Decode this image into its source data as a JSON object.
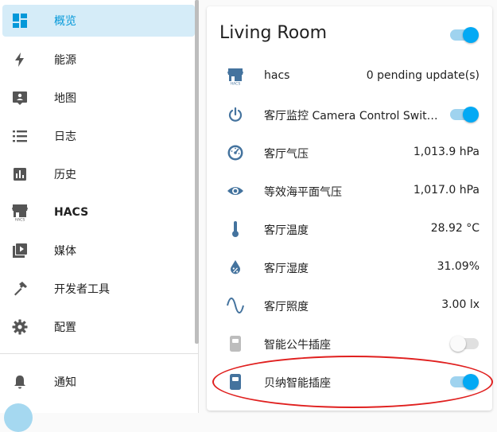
{
  "sidebar": {
    "items": [
      {
        "label": "概览",
        "icon": "dashboard-icon"
      },
      {
        "label": "能源",
        "icon": "lightning-icon"
      },
      {
        "label": "地图",
        "icon": "map-icon"
      },
      {
        "label": "日志",
        "icon": "logbook-icon"
      },
      {
        "label": "历史",
        "icon": "history-chart-icon"
      },
      {
        "label": "HACS",
        "icon": "hacs-store-icon"
      },
      {
        "label": "媒体",
        "icon": "media-icon"
      },
      {
        "label": "开发者工具",
        "icon": "hammer-icon"
      },
      {
        "label": "配置",
        "icon": "gear-icon"
      }
    ],
    "notifications": {
      "label": "通知",
      "icon": "bell-icon"
    }
  },
  "card": {
    "title": "Living Room",
    "header_toggle": "on",
    "rows": [
      {
        "name": "hacs",
        "value": "0 pending update(s)",
        "icon": "hacs-store-icon"
      },
      {
        "name": "客厅监控 Camera Control Switch ...",
        "icon": "power-icon",
        "toggle": "on"
      },
      {
        "name": "客厅气压",
        "value": "1,013.9 hPa",
        "icon": "gauge-icon"
      },
      {
        "name": "等效海平面气压",
        "value": "1,017.0 hPa",
        "icon": "eye-icon"
      },
      {
        "name": "客厅温度",
        "value": "28.92 °C",
        "icon": "thermometer-icon"
      },
      {
        "name": "客厅湿度",
        "value": "31.09%",
        "icon": "water-percent-icon"
      },
      {
        "name": "客厅照度",
        "value": "3.00 lx",
        "icon": "sine-wave-icon"
      },
      {
        "name": "智能公牛插座",
        "icon": "power-socket-icon",
        "toggle": "off"
      },
      {
        "name": "贝纳智能插座",
        "icon": "power-socket-icon",
        "toggle": "on"
      }
    ]
  },
  "colors": {
    "accent": "#03a9f4",
    "active_bg": "#d5ecf8",
    "icon": "#44739e",
    "highlight": "#e0201f"
  }
}
